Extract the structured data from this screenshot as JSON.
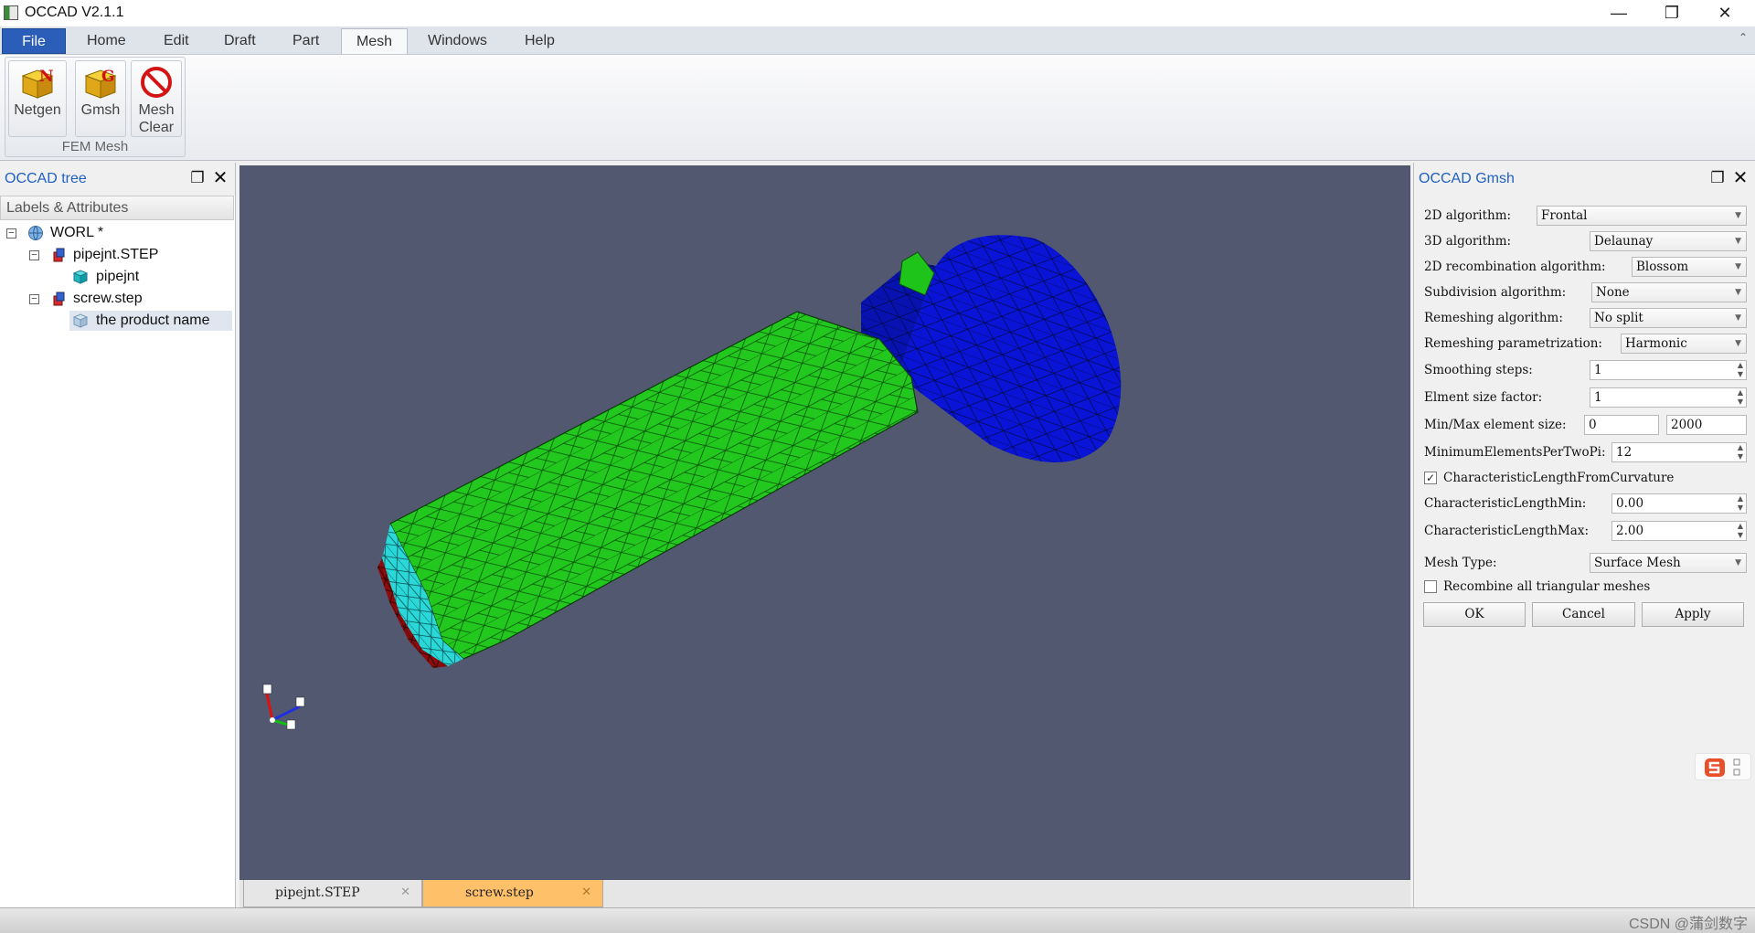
{
  "window": {
    "title": "OCCAD V2.1.1",
    "minimize": "—",
    "restore": "❐",
    "close": "✕"
  },
  "menu": {
    "items": [
      "File",
      "Home",
      "Edit",
      "Draft",
      "Part",
      "Mesh",
      "Windows",
      "Help"
    ],
    "active": "Mesh",
    "collapse": "⌃"
  },
  "ribbon": {
    "group_label": "FEM Mesh",
    "buttons": [
      {
        "line1": "Netgen",
        "line2": "",
        "icon": "netgen-icon"
      },
      {
        "line1": "Gmsh",
        "line2": "",
        "icon": "gmsh-icon"
      },
      {
        "line1": "Mesh",
        "line2": "Clear",
        "icon": "no-entry-icon"
      }
    ]
  },
  "tree_panel": {
    "title": "OCCAD tree",
    "header": "Labels & Attributes",
    "nodes": [
      {
        "label": "WORL *",
        "icon": "globe-icon"
      },
      {
        "label": "pipejnt.STEP",
        "icon": "shape-icon"
      },
      {
        "label": "pipejnt",
        "icon": "cube-icon"
      },
      {
        "label": "screw.step",
        "icon": "shape-icon"
      },
      {
        "label": "the product name",
        "icon": "cube-icon"
      }
    ]
  },
  "doc_tabs": [
    {
      "label": "pipejnt.STEP",
      "active": false
    },
    {
      "label": "screw.step",
      "active": true
    }
  ],
  "gmsh_panel": {
    "title": "OCCAD Gmsh",
    "rows": {
      "alg2d": {
        "label": "2D algorithm:",
        "value": "Frontal"
      },
      "alg3d": {
        "label": "3D algorithm:",
        "value": "Delaunay"
      },
      "recomb": {
        "label": "2D recombination algorithm:",
        "value": "Blossom"
      },
      "subdiv": {
        "label": "Subdivision algorithm:",
        "value": "None"
      },
      "remesh": {
        "label": "Remeshing algorithm:",
        "value": "No split"
      },
      "remeshparam": {
        "label": "Remeshing parametrization:",
        "value": "Harmonic"
      },
      "smooth": {
        "label": "Smoothing steps:",
        "value": "1"
      },
      "sizefactor": {
        "label": "Elment size factor:",
        "value": "1"
      },
      "minmax": {
        "label": "Min/Max element size:",
        "min": "0",
        "max": "2000"
      },
      "minelem": {
        "label": "MinimumElementsPerTwoPi:",
        "value": "12"
      },
      "curv": {
        "label": "CharacteristicLengthFromCurvature",
        "checked": true,
        "mark": "✓"
      },
      "clmin": {
        "label": "CharacteristicLengthMin:",
        "value": "0.00"
      },
      "clmax": {
        "label": "CharacteristicLengthMax:",
        "value": "2.00"
      },
      "meshtype": {
        "label": "Mesh Type:",
        "value": "Surface Mesh"
      },
      "recomball": {
        "label": "Recombine all triangular meshes",
        "checked": false,
        "mark": ""
      }
    },
    "buttons": {
      "ok": "OK",
      "cancel": "Cancel",
      "apply": "Apply"
    }
  },
  "statusbar": {
    "watermark": "CSDN @蒲剑数字"
  },
  "colors": {
    "viewport": "#525870",
    "shank": "#22c81e",
    "head": "#0a14d6",
    "slot": "#2ad8d8",
    "end": "#8a0c0c",
    "accent": "#2060c0",
    "active_tab": "#ffc06a"
  }
}
